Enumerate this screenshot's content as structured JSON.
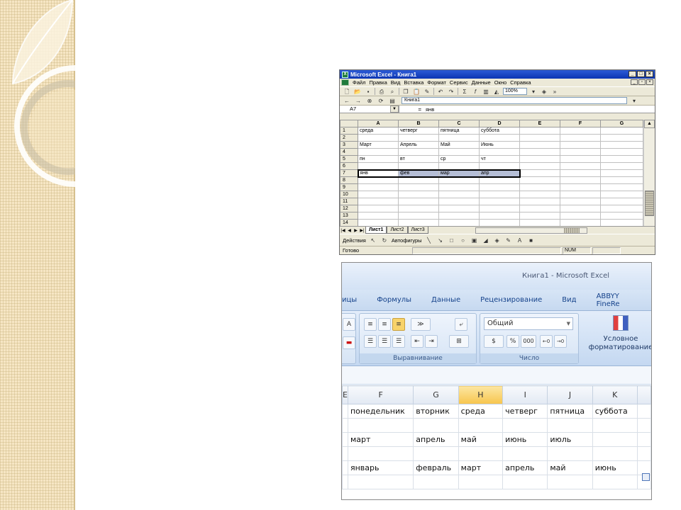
{
  "xl2003": {
    "title": "Microsoft Excel - Книга1",
    "menu": [
      "Файл",
      "Правка",
      "Вид",
      "Вставка",
      "Формат",
      "Сервис",
      "Данные",
      "Окно",
      "Справка"
    ],
    "zoom": "100%",
    "web_address": "Книга1",
    "name_box": "A7",
    "formula_eq": "=",
    "formula_value": "янв",
    "columns": [
      "A",
      "B",
      "C",
      "D",
      "E",
      "F",
      "G"
    ],
    "rows": [
      {
        "n": "1",
        "cells": [
          "среда",
          "четверг",
          "пятница",
          "суббота",
          "",
          "",
          ""
        ]
      },
      {
        "n": "2",
        "cells": [
          "",
          "",
          "",
          "",
          "",
          "",
          ""
        ]
      },
      {
        "n": "3",
        "cells": [
          "Март",
          "Апрель",
          "Май",
          "Июнь",
          "",
          "",
          ""
        ]
      },
      {
        "n": "4",
        "cells": [
          "",
          "",
          "",
          "",
          "",
          "",
          ""
        ]
      },
      {
        "n": "5",
        "cells": [
          "пн",
          "вт",
          "ср",
          "чт",
          "",
          "",
          ""
        ]
      },
      {
        "n": "6",
        "cells": [
          "",
          "",
          "",
          "",
          "",
          "",
          ""
        ]
      },
      {
        "n": "7",
        "cells": [
          "янв",
          "фев",
          "мар",
          "апр",
          "",
          "",
          ""
        ]
      },
      {
        "n": "8",
        "cells": [
          "",
          "",
          "",
          "",
          "",
          "",
          ""
        ]
      },
      {
        "n": "9",
        "cells": [
          "",
          "",
          "",
          "",
          "",
          "",
          ""
        ]
      },
      {
        "n": "10",
        "cells": [
          "",
          "",
          "",
          "",
          "",
          "",
          ""
        ]
      },
      {
        "n": "11",
        "cells": [
          "",
          "",
          "",
          "",
          "",
          "",
          ""
        ]
      },
      {
        "n": "12",
        "cells": [
          "",
          "",
          "",
          "",
          "",
          "",
          ""
        ]
      },
      {
        "n": "13",
        "cells": [
          "",
          "",
          "",
          "",
          "",
          "",
          ""
        ]
      },
      {
        "n": "14",
        "cells": [
          "",
          "",
          "",
          "",
          "",
          "",
          ""
        ]
      }
    ],
    "selected_row": "7",
    "sheet_tabs": [
      "Лист1",
      "Лист2",
      "Лист3"
    ],
    "active_sheet": "Лист1",
    "draw_actions": "Действия",
    "autoshapes": "Автофигуры",
    "status": "Готово",
    "num_indicator": "NUM"
  },
  "xl2007": {
    "title": "Книга1 - Microsoft Excel",
    "tabs": [
      "ицы",
      "Формулы",
      "Данные",
      "Рецензирование",
      "Вид",
      "ABBYY FineRe"
    ],
    "number_format": "Общий",
    "group_alignment": "Выравнивание",
    "group_number": "Число",
    "percent_label": "%",
    "thousands_label": "000",
    "cond_format_line1": "Условное",
    "cond_format_line2": "форматирование",
    "columns": [
      "E",
      "F",
      "G",
      "H",
      "I",
      "J",
      "K"
    ],
    "highlight_column": "H",
    "rows": [
      [
        "",
        "понедельник",
        "вторник",
        "среда",
        "четверг",
        "пятница",
        "суббота"
      ],
      [
        "",
        "",
        "",
        "",
        "",
        "",
        ""
      ],
      [
        "",
        "март",
        "апрель",
        "май",
        "июнь",
        "июль",
        ""
      ],
      [
        "",
        "",
        "",
        "",
        "",
        "",
        ""
      ],
      [
        "",
        "январь",
        "февраль",
        "март",
        "апрель",
        "май",
        "июнь"
      ],
      [
        "",
        "",
        "",
        "",
        "",
        "",
        ""
      ]
    ]
  }
}
